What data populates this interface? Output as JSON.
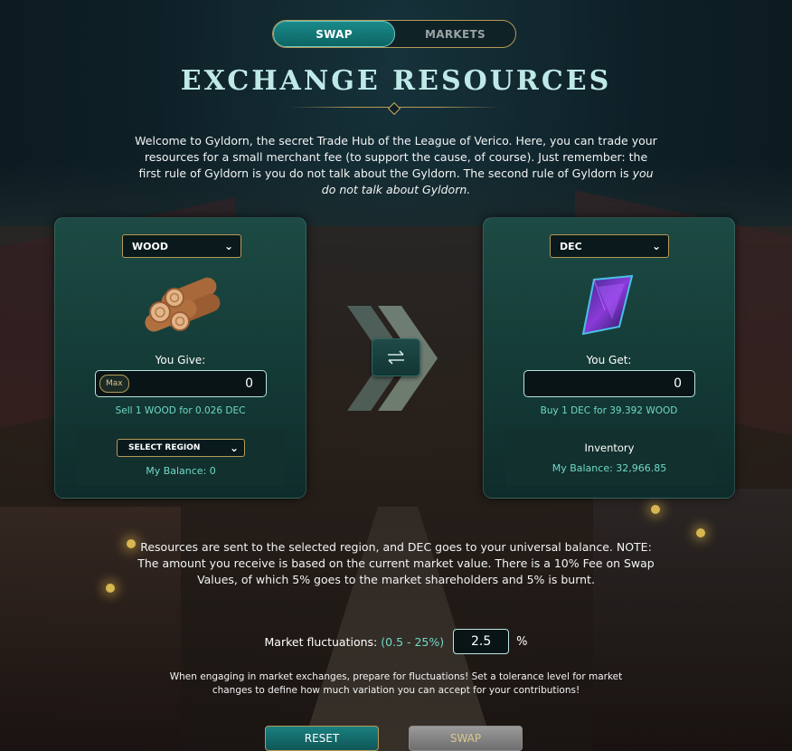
{
  "tabs": {
    "swap": "SWAP",
    "markets": "MARKETS"
  },
  "page_title": "EXCHANGE RESOURCES",
  "intro": {
    "text": "Welcome to Gyldorn, the secret Trade Hub of the League of Verico. Here, you can trade your resources for a small merchant fee (to support the cause, of course). Just remember: the first rule of Gyldorn is you do not talk about the Gyldorn. The second rule of Gyldorn is ",
    "emphasis": "you do not talk about Gyldorn."
  },
  "give_panel": {
    "resource": "WOOD",
    "label": "You Give:",
    "max_label": "Max",
    "amount": "0",
    "rate": "Sell 1 WOOD for 0.026 DEC",
    "region_select": "SELECT REGION",
    "balance": "My Balance: 0"
  },
  "get_panel": {
    "resource": "DEC",
    "label": "You Get:",
    "amount": "0",
    "rate": "Buy 1 DEC for 39.392 WOOD",
    "inventory_label": "Inventory",
    "balance": "My Balance: 32,966.85"
  },
  "note": "Resources are sent to the selected region, and DEC goes to your universal balance. NOTE: The amount you receive is based on the current market value. There is a 10% Fee on Swap Values, of which 5% goes to the market shareholders and 5% is burnt.",
  "fluctuation": {
    "label": "Market fluctuations:",
    "range": "(0.5 - 25%)",
    "value": "2.5",
    "unit": "%"
  },
  "hint": "When engaging in market exchanges, prepare for fluctuations! Set a tolerance level for market changes to define how much variation you can accept for your contributions!",
  "buttons": {
    "reset": "RESET",
    "swap": "SWAP"
  },
  "icons": {
    "resource_give": "wood-logs-icon",
    "resource_get": "dec-crystal-icon",
    "swap_direction": "swap-arrows-icon"
  },
  "colors": {
    "accent_teal": "#6fd8c8",
    "gold_border": "#b59a58",
    "title": "#bfe9e6"
  }
}
